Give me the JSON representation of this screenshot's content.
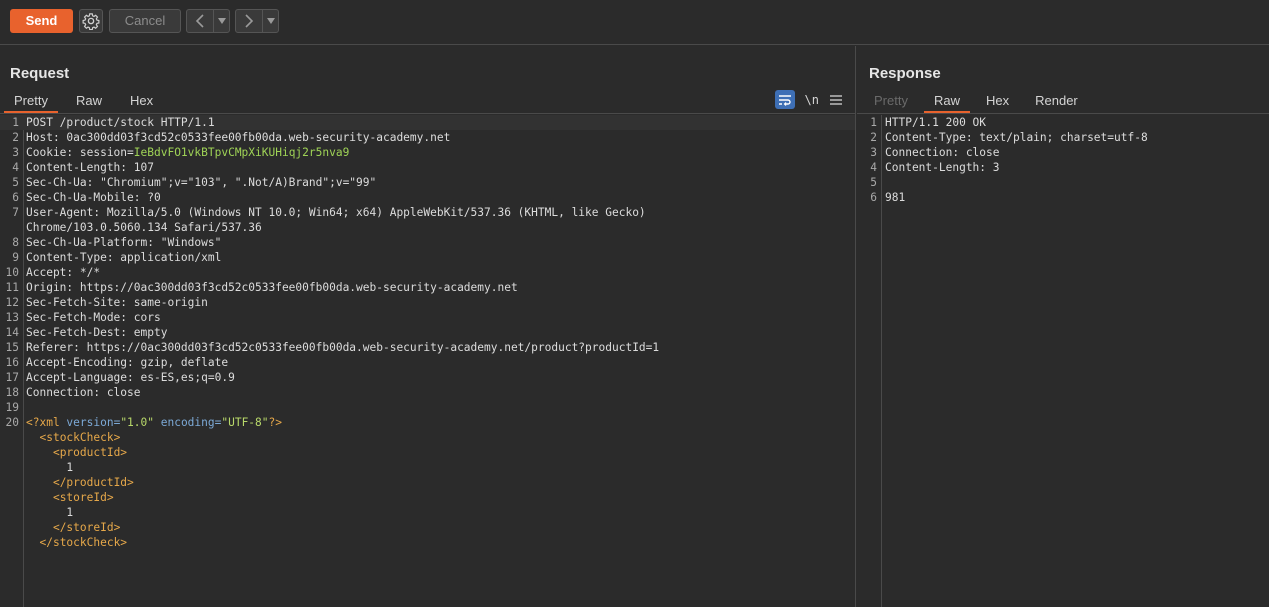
{
  "toolbar": {
    "send_label": "Send",
    "cancel_label": "Cancel"
  },
  "request": {
    "title": "Request",
    "tabs": [
      {
        "label": "Pretty",
        "active": true
      },
      {
        "label": "Raw",
        "active": false
      },
      {
        "label": "Hex",
        "active": false
      }
    ],
    "tools": {
      "wrap_icon": "word-wrap-icon",
      "newline_label": "\\n",
      "menu_icon": "hamburger-menu-icon"
    },
    "lines": [
      {
        "n": "1",
        "text": "POST /product/stock HTTP/1.1"
      },
      {
        "n": "2",
        "text": "Host: 0ac300dd03f3cd52c0533fee00fb00da.web-security-academy.net"
      },
      {
        "n": "3",
        "key": "Cookie: session=",
        "value": "IeBdvFO1vkBTpvCMpXiKUHiqj2r5nva9"
      },
      {
        "n": "4",
        "text": "Content-Length: 107"
      },
      {
        "n": "5",
        "text": "Sec-Ch-Ua: \"Chromium\";v=\"103\", \".Not/A)Brand\";v=\"99\""
      },
      {
        "n": "6",
        "text": "Sec-Ch-Ua-Mobile: ?0"
      },
      {
        "n": "7",
        "text": "User-Agent: Mozilla/5.0 (Windows NT 10.0; Win64; x64) AppleWebKit/537.36 (KHTML, like Gecko)"
      },
      {
        "n": "",
        "text": "Chrome/103.0.5060.134 Safari/537.36"
      },
      {
        "n": "8",
        "text": "Sec-Ch-Ua-Platform: \"Windows\""
      },
      {
        "n": "9",
        "text": "Content-Type: application/xml"
      },
      {
        "n": "10",
        "text": "Accept: */*"
      },
      {
        "n": "11",
        "text": "Origin: https://0ac300dd03f3cd52c0533fee00fb00da.web-security-academy.net"
      },
      {
        "n": "12",
        "text": "Sec-Fetch-Site: same-origin"
      },
      {
        "n": "13",
        "text": "Sec-Fetch-Mode: cors"
      },
      {
        "n": "14",
        "text": "Sec-Fetch-Dest: empty"
      },
      {
        "n": "15",
        "text": "Referer: https://0ac300dd03f3cd52c0533fee00fb00da.web-security-academy.net/product?productId=1"
      },
      {
        "n": "16",
        "text": "Accept-Encoding: gzip, deflate"
      },
      {
        "n": "17",
        "text": "Accept-Language: es-ES,es;q=0.9"
      },
      {
        "n": "18",
        "text": "Connection: close"
      },
      {
        "n": "19",
        "text": ""
      },
      {
        "n": "20",
        "xmldecl": {
          "open": "<?xml ",
          "attr1": "version=",
          "val1": "\"1.0\"",
          "attr2": " encoding=",
          "val2": "\"UTF-8\"",
          "close": "?>"
        }
      },
      {
        "n": "",
        "indent": "  ",
        "tag": "<stockCheck>"
      },
      {
        "n": "",
        "indent": "    ",
        "tag": "<productId>"
      },
      {
        "n": "",
        "indent": "      ",
        "text": "1"
      },
      {
        "n": "",
        "indent": "    ",
        "tag": "</productId>"
      },
      {
        "n": "",
        "indent": "    ",
        "tag": "<storeId>"
      },
      {
        "n": "",
        "indent": "      ",
        "text": "1"
      },
      {
        "n": "",
        "indent": "    ",
        "tag": "</storeId>"
      },
      {
        "n": "",
        "indent": "  ",
        "tag": "</stockCheck>"
      }
    ]
  },
  "response": {
    "title": "Response",
    "tabs": [
      {
        "label": "Pretty",
        "active": false,
        "disabled": true
      },
      {
        "label": "Raw",
        "active": true
      },
      {
        "label": "Hex",
        "active": false
      },
      {
        "label": "Render",
        "active": false
      }
    ],
    "lines": [
      {
        "n": "1",
        "text": "HTTP/1.1 200 OK"
      },
      {
        "n": "2",
        "text": "Content-Type: text/plain; charset=utf-8"
      },
      {
        "n": "3",
        "text": "Connection: close"
      },
      {
        "n": "4",
        "text": "Content-Length: 3"
      },
      {
        "n": "5",
        "text": ""
      },
      {
        "n": "6",
        "text": "981"
      }
    ]
  },
  "colors": {
    "accent": "#e8622d",
    "cookie_value": "#9fd356",
    "xml_tag": "#e6a84a",
    "xml_attr": "#7ca9d6",
    "xml_string": "#b8d86a"
  }
}
